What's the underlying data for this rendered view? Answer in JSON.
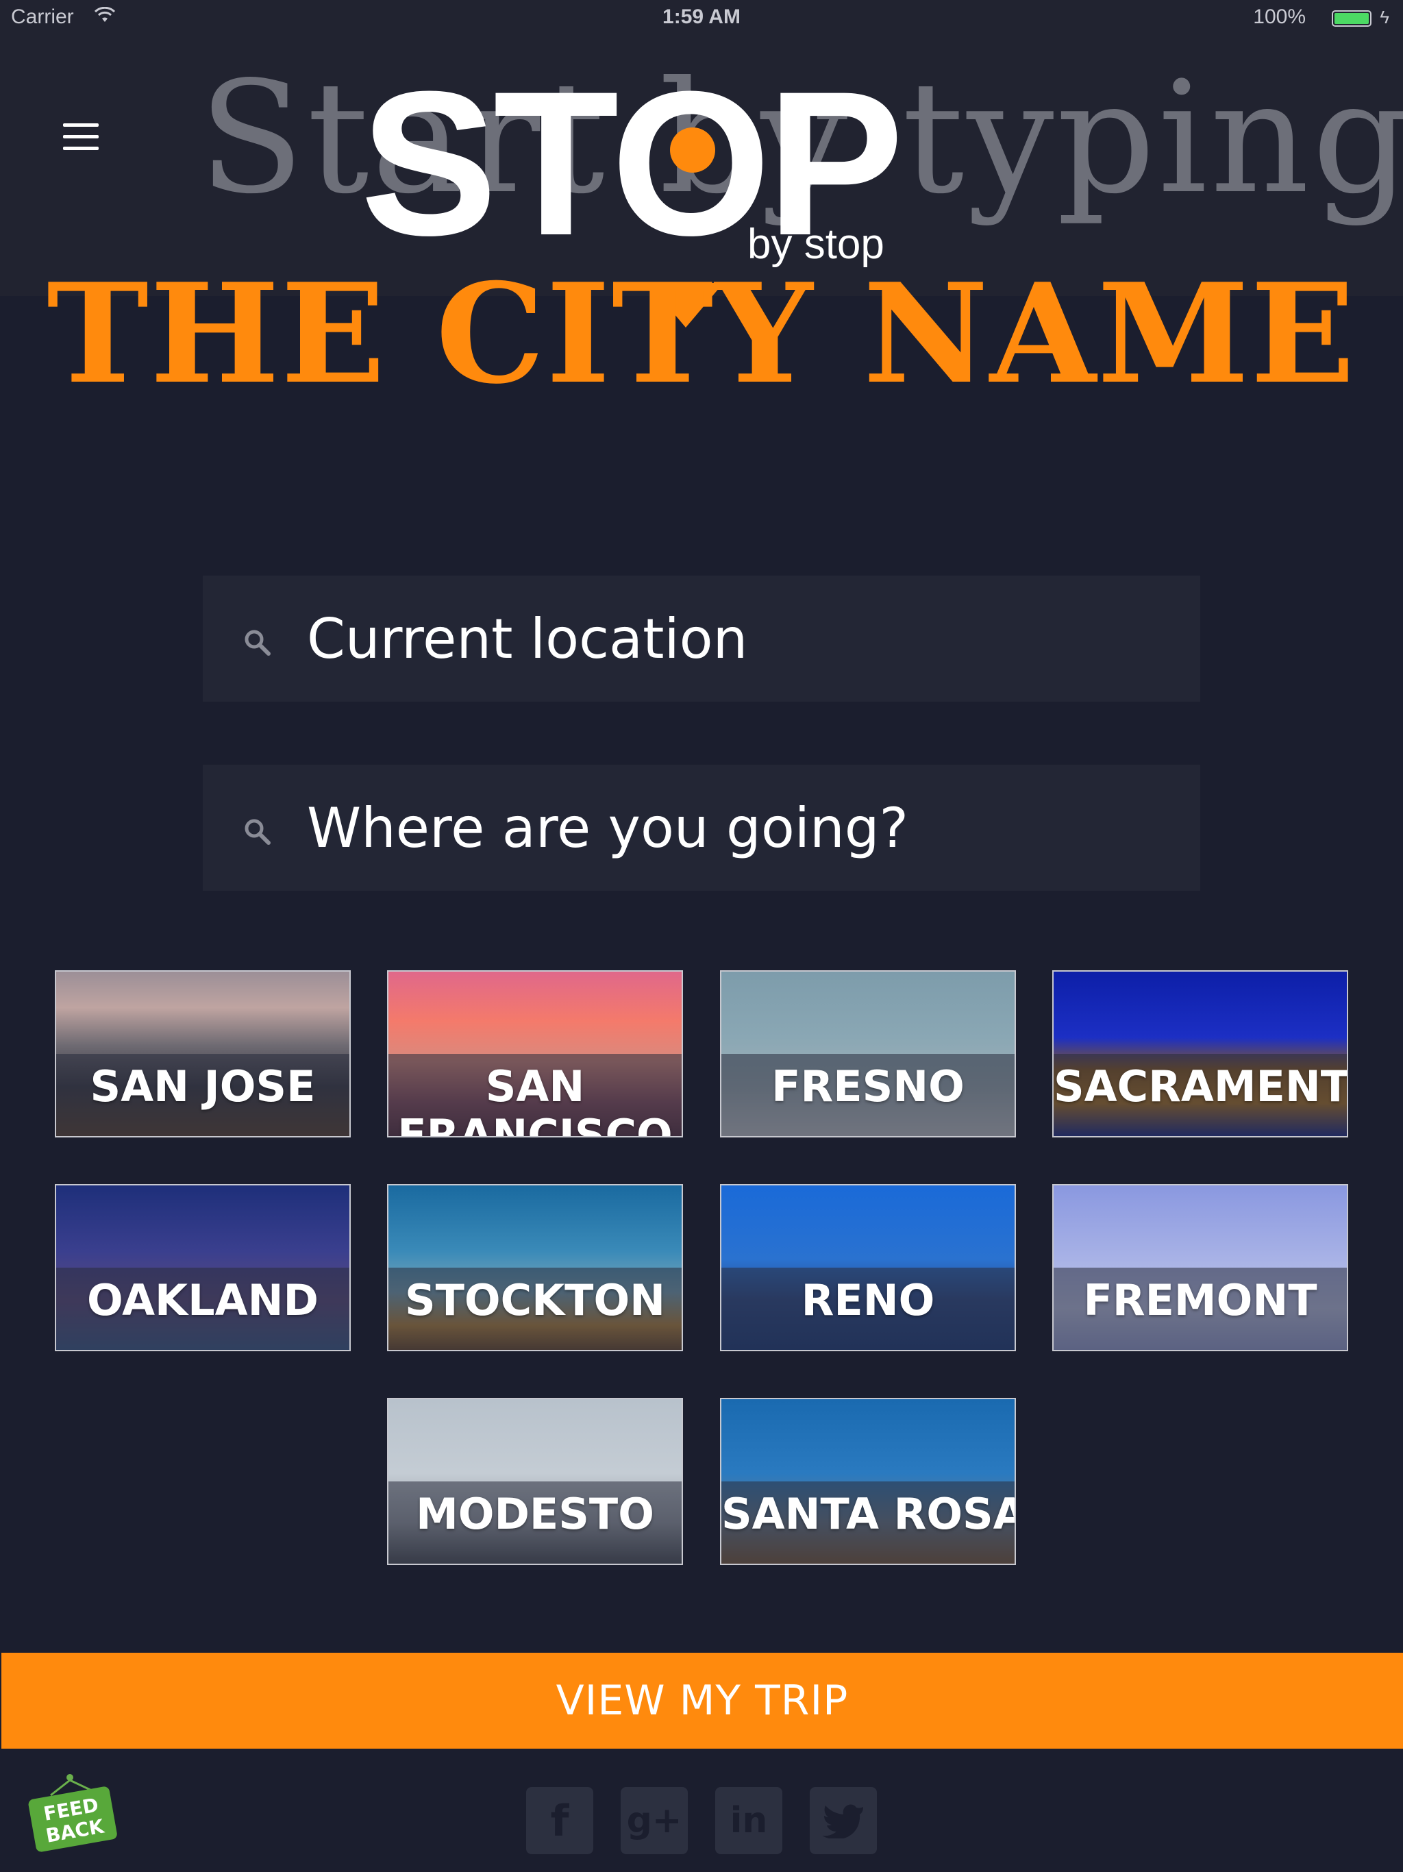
{
  "status_bar": {
    "carrier": "Carrier",
    "time": "1:59 AM",
    "battery": "100%"
  },
  "header": {
    "background_headline": "Start by typing",
    "logo_text": "STOP",
    "logo_tagline": "by stop",
    "menu_icon": "hamburger-menu-icon"
  },
  "headline": "THE CITY NAME",
  "search": {
    "origin_value": "Current location",
    "destination_placeholder": "Where are you going?",
    "icon": "search-icon"
  },
  "cities": [
    {
      "name": "SAN JOSE"
    },
    {
      "name": "SAN FRANCISCO"
    },
    {
      "name": "FRESNO"
    },
    {
      "name": "SACRAMENTO"
    },
    {
      "name": "OAKLAND"
    },
    {
      "name": "STOCKTON"
    },
    {
      "name": "RENO"
    },
    {
      "name": "FREMONT"
    },
    {
      "name": "MODESTO"
    },
    {
      "name": "SANTA ROSA"
    }
  ],
  "view_trip_label": "VIEW MY TRIP",
  "footer": {
    "feedback_label": "FEED BACK",
    "social_icons": [
      "facebook-icon",
      "google-plus-icon",
      "linkedin-icon",
      "twitter-icon"
    ]
  },
  "colors": {
    "accent": "#ff8a0d",
    "background": "#1b1e2e",
    "header": "#212330",
    "field": "#232635"
  }
}
